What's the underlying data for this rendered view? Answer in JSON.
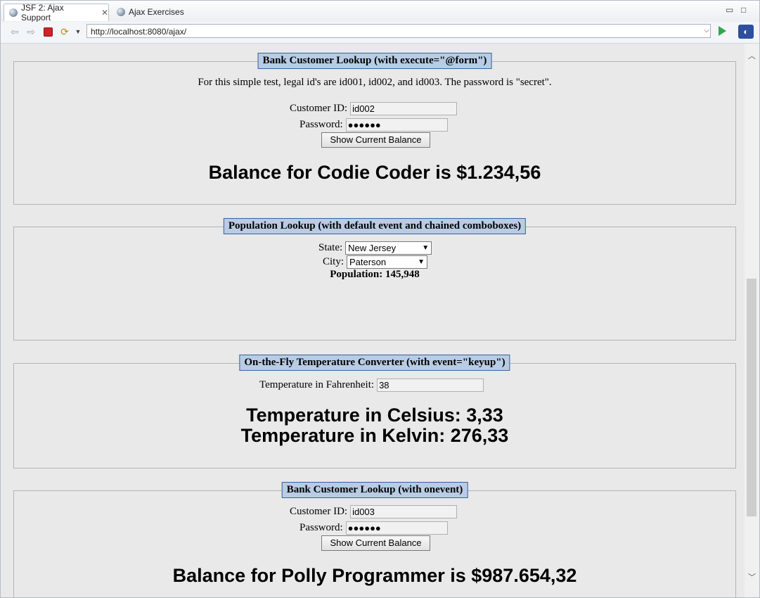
{
  "tabs": [
    {
      "label": "JSF 2: Ajax Support",
      "icon": "globe-icon"
    },
    {
      "label": "Ajax Exercises",
      "icon": "globe-icon"
    }
  ],
  "toolbar": {
    "url": "http://localhost:8080/ajax/"
  },
  "panel1": {
    "legend": "Bank Customer Lookup (with execute=\"@form\")",
    "intro": "For this simple test, legal id's are id001, id002, and id003. The password is \"secret\".",
    "id_label": "Customer ID:",
    "id_value": "id002",
    "pw_label": "Password:",
    "pw_value": "●●●●●●",
    "button": "Show Current Balance",
    "result": "Balance for Codie Coder is $1.234,56"
  },
  "panel2": {
    "legend": "Population Lookup (with default event and chained comboboxes)",
    "state_label": "State:",
    "state_value": "New Jersey",
    "city_label": "City:",
    "city_value": "Paterson",
    "population": "Population: 145,948"
  },
  "panel3": {
    "legend": "On-the-Fly Temperature Converter (with event=\"keyup\")",
    "temp_label": "Temperature in Fahrenheit:",
    "temp_value": "38",
    "celsius": "Temperature in Celsius: 3,33",
    "kelvin": "Temperature in Kelvin: 276,33"
  },
  "panel4": {
    "legend": "Bank Customer Lookup (with onevent)",
    "id_label": "Customer ID:",
    "id_value": "id003",
    "pw_label": "Password:",
    "pw_value": "●●●●●●",
    "button": "Show Current Balance",
    "result": "Balance for Polly Programmer is $987.654,32"
  }
}
